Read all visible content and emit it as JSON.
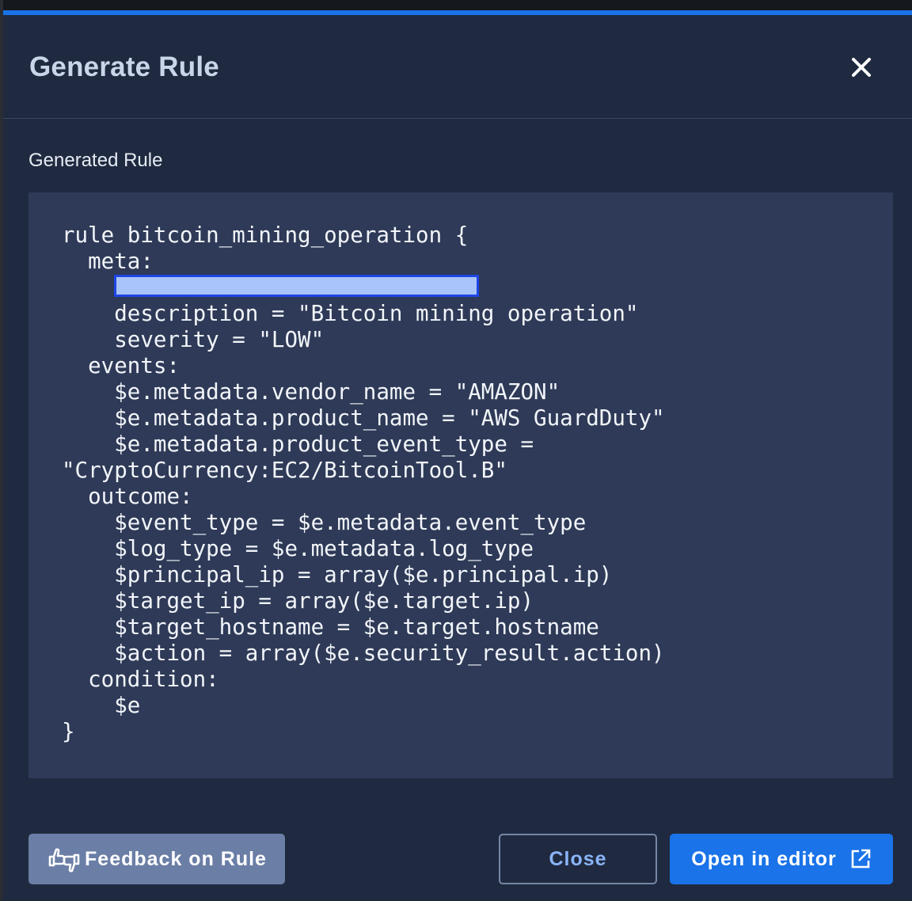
{
  "dialog": {
    "title": "Generate Rule",
    "close_icon": "close-icon",
    "accent_color": "#1a73e8"
  },
  "section": {
    "label": "Generated Rule"
  },
  "code": {
    "lines_before_redaction": [
      "rule bitcoin_mining_operation {",
      "  meta:"
    ],
    "redacted_line_prefix": "    ",
    "redacted_line_suffix": "",
    "lines_after_redaction": [
      "    description = \"Bitcoin mining operation\"",
      "    severity = \"LOW\"",
      "  events:",
      "    $e.metadata.vendor_name = \"AMAZON\"",
      "    $e.metadata.product_name = \"AWS GuardDuty\"",
      "    $e.metadata.product_event_type =",
      "\"CryptoCurrency:EC2/BitcoinTool.B\"",
      "  outcome:",
      "    $event_type = $e.metadata.event_type",
      "    $log_type = $e.metadata.log_type",
      "    $principal_ip = array($e.principal.ip)",
      "    $target_ip = array($e.target.ip)",
      "    $target_hostname = $e.target.hostname",
      "    $action = array($e.security_result.action)",
      "  condition:",
      "    $e",
      "}"
    ]
  },
  "footer": {
    "feedback_label": "Feedback on Rule",
    "feedback_icon": "thumbs-feedback-icon",
    "close_label": "Close",
    "open_label": "Open in editor",
    "open_icon": "external-link-icon"
  }
}
